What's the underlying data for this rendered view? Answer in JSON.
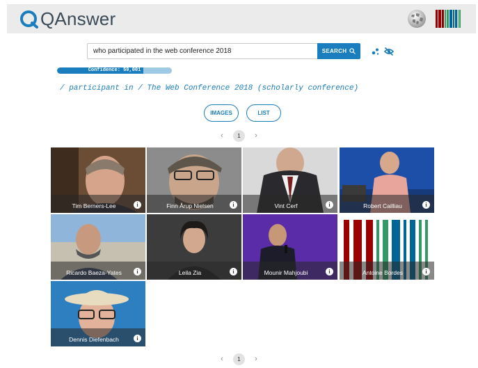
{
  "app": {
    "logo_text": "QAnswer"
  },
  "search": {
    "query": "who participated in the web conference 2018",
    "button_label": "SEARCH"
  },
  "confidence": {
    "label": "Confidence: 59,001",
    "value_fraction": 0.75
  },
  "answer": {
    "path": "/ participant in / The Web Conference 2018 (scholarly conference)"
  },
  "views": {
    "images_label": "IMAGES",
    "list_label": "LIST"
  },
  "pagination": {
    "prev": "‹",
    "current": "1",
    "next": "›"
  },
  "results": [
    {
      "name": "Tim Berners-Lee"
    },
    {
      "name": "Finn Årup Nielsen"
    },
    {
      "name": "Vint Cerf"
    },
    {
      "name": "Robert Cailliau"
    },
    {
      "name": "Ricardo Baeza-Yates"
    },
    {
      "name": "Leila Zia"
    },
    {
      "name": "Mounir Mahjoubi"
    },
    {
      "name": "Antoine Bordes"
    },
    {
      "name": "Dennis Diefenbach"
    }
  ],
  "colors": {
    "accent": "#1a7dbd",
    "header_bg": "#ebebeb",
    "wikidata_red": "#990000",
    "wikidata_green": "#339966",
    "wikidata_blue": "#006699"
  }
}
